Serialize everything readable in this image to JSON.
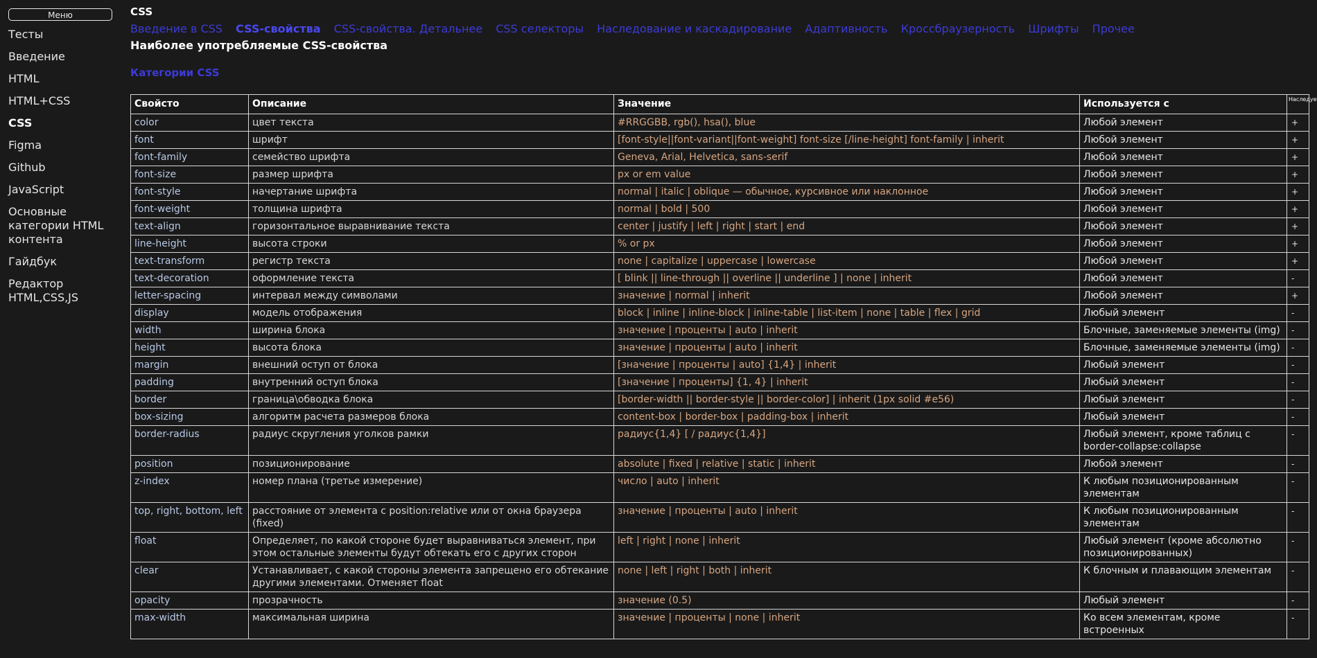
{
  "sidebar": {
    "menu_label": "Меню",
    "items": [
      {
        "label": "Тесты"
      },
      {
        "label": "Введение"
      },
      {
        "label": "HTML"
      },
      {
        "label": "HTML+CSS"
      },
      {
        "label": "CSS"
      },
      {
        "label": "Figma"
      },
      {
        "label": "Github"
      },
      {
        "label": "JavaScript"
      },
      {
        "label": "Основные категории HTML контента"
      },
      {
        "label": "Гайдбук"
      },
      {
        "label": "Редактор HTML,CSS,JS"
      }
    ]
  },
  "page": {
    "title": "CSS",
    "tabs": [
      {
        "label": "Введение в CSS"
      },
      {
        "label": "CSS-свойства"
      },
      {
        "label": "CSS-свойства. Детальнее"
      },
      {
        "label": "CSS селекторы"
      },
      {
        "label": "Наследование и каскадирование"
      },
      {
        "label": "Адаптивность"
      },
      {
        "label": "Кроссбраузерность"
      },
      {
        "label": "Шрифты"
      },
      {
        "label": "Прочее"
      }
    ],
    "heading": "Наиболее употребляемые CSS-свойства",
    "subheading": "Категории CSS"
  },
  "table": {
    "headers": [
      "Свойсто",
      "Описание",
      "Значение",
      "Используется с",
      "Наследуется"
    ],
    "rows": [
      [
        "color",
        "цвет текста",
        "#RRGGBB, rgb(), hsa(), blue",
        "Любой элемент",
        "+"
      ],
      [
        "font",
        "шрифт",
        "[font-style||font-variant||font-weight] font-size [/line-height] font-family | inherit",
        "Любой элемент",
        "+"
      ],
      [
        "font-family",
        "семейство шрифта",
        "Geneva, Arial, Helvetica, sans-serif",
        "Любой элемент",
        "+"
      ],
      [
        "font-size",
        "размер шрифта",
        "px or em value",
        "Любой элемент",
        "+"
      ],
      [
        "font-style",
        "начертание шрифта",
        "normal | italic | oblique — обычное, курсивное или наклонное",
        "Любой элемент",
        "+"
      ],
      [
        "font-weight",
        "толщина шрифта",
        "normal | bold | 500",
        "Любой элемент",
        "+"
      ],
      [
        "text-align",
        "горизонтальное выравнивание текста",
        "center | justify | left | right | start | end",
        "Любой элемент",
        "+"
      ],
      [
        "line-height",
        "высота строки",
        "% or px",
        "Любой элемент",
        "+"
      ],
      [
        "text-transform",
        "регистр текста",
        "none | capitalize | uppercase | lowercase",
        "Любой элемент",
        "+"
      ],
      [
        "text-decoration",
        "оформление текста",
        "[ blink || line-through || overline || underline ] | none | inherit",
        "Любой элемент",
        "-"
      ],
      [
        "letter-spacing",
        "интервал между символами",
        "значение | normal | inherit",
        "Любой элемент",
        "+"
      ],
      [
        "display",
        "модель отображения",
        "block | inline | inline-block | inline-table | list-item | none | table | flex | grid",
        "Любый элемент",
        "-"
      ],
      [
        "width",
        "ширина блока",
        "значение | проценты | auto | inherit",
        "Блочные, заменяемые элементы (img)",
        "-"
      ],
      [
        "height",
        "высота блока",
        "значение | проценты | auto | inherit",
        "Блочные, заменяемые элементы (img)",
        "-"
      ],
      [
        "margin",
        "внешний оступ от блока",
        "[значение | проценты | auto] {1,4} | inherit",
        "Любый элемент",
        "-"
      ],
      [
        "padding",
        "внутренний оступ блока",
        "[значение | проценты] {1, 4} | inherit",
        "Любый элемент",
        "-"
      ],
      [
        "border",
        "граница\\обводка блока",
        "[border-width || border-style || border-color] | inherit (1px solid #e56)",
        "Любый элемент",
        "-"
      ],
      [
        "box-sizing",
        "алгоритм расчета размеров блока",
        "content-box | border-box | padding-box | inherit",
        "Любый элемент",
        "-"
      ],
      [
        "border-radius",
        "радиус скругления уголков рамки",
        "радиус{1,4} [ / радиус{1,4}]",
        "Любый элемент, кроме таблиц с border-collapse:collapse",
        "-"
      ],
      [
        "position",
        "позиционирование",
        "absolute | fixed | relative | static | inherit",
        "Любой элемент",
        "-"
      ],
      [
        "z-index",
        "номер плана (третье измерение)",
        "число | auto | inherit",
        "К любым позиционированным элементам",
        "-"
      ],
      [
        "top, right, bottom, left",
        "расстояние от элемента с position:relative или от окна браузера (fixed)",
        "значение | проценты | auto | inherit",
        "К любым позиционированным элементам",
        "-"
      ],
      [
        "float",
        "Определяет, по какой стороне будет выравниваться элемент, при этом остальные элементы будут обтекать его с других сторон",
        "left | right | none | inherit",
        "Любый элемент (кроме абсолютно позиционированных)",
        "-"
      ],
      [
        "clear",
        "Устанавливает, с какой стороны элемента запрещено его обтекание другими элементами. Отменяет float",
        "none | left | right | both | inherit",
        "К блочным и плавающим элементам",
        "-"
      ],
      [
        "opacity",
        "прозрачность",
        "значение (0.5)",
        "Любый элемент",
        "-"
      ],
      [
        "max-width",
        "максимальная ширина",
        "значение | проценты | none | inherit",
        "Ко всем элементам, кроме встроенных",
        "-"
      ]
    ]
  }
}
